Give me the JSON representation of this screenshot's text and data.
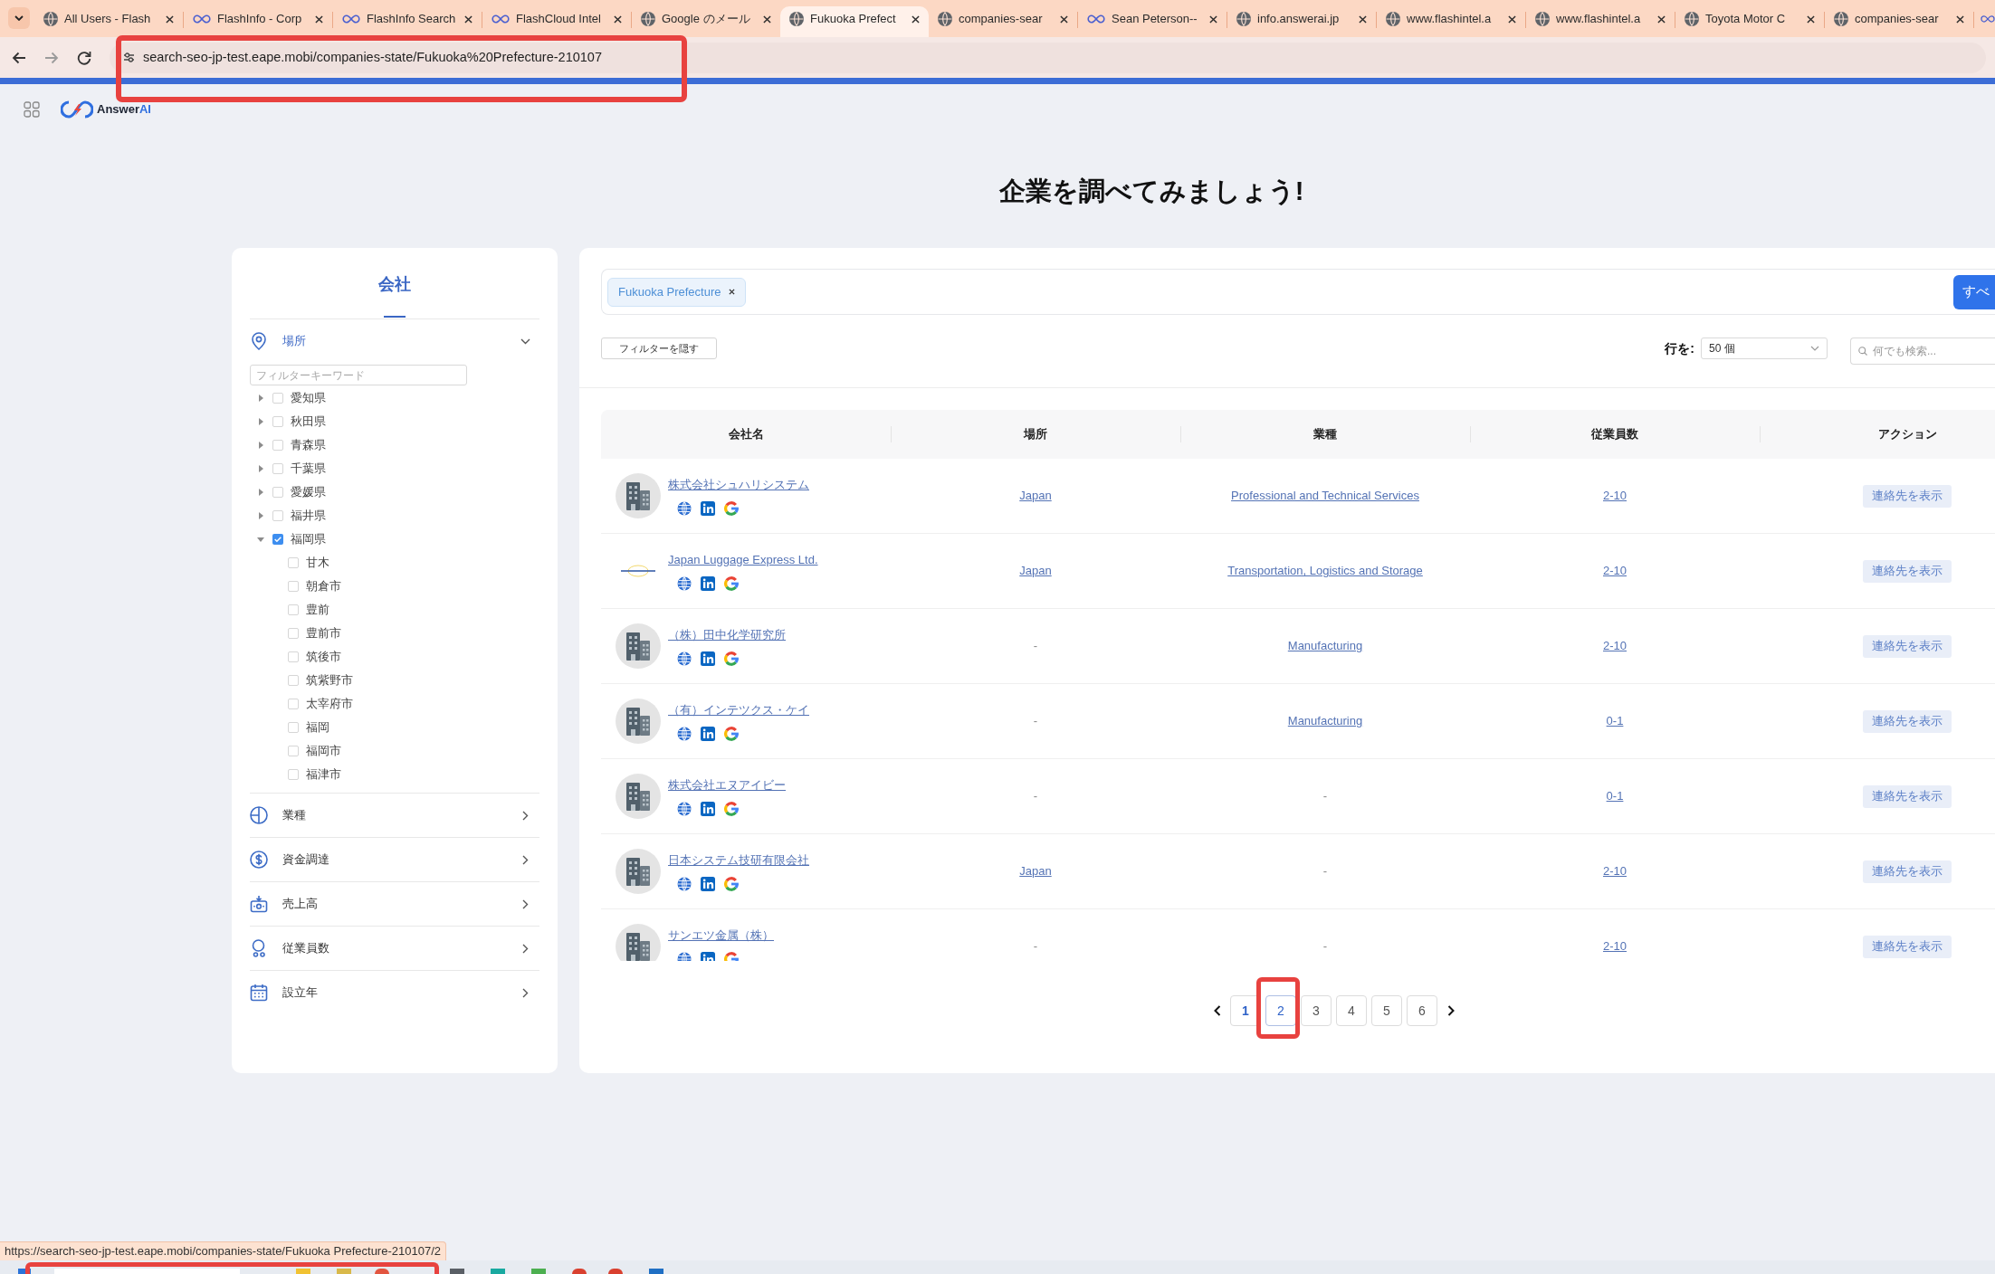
{
  "browser": {
    "tabs": [
      {
        "title": "All Users - Flash",
        "kind": "globe",
        "selected": false
      },
      {
        "title": "FlashInfo - Corp",
        "kind": "link",
        "selected": false
      },
      {
        "title": "FlashInfo Search",
        "kind": "link",
        "selected": false
      },
      {
        "title": "FlashCloud Intel",
        "kind": "link",
        "selected": false
      },
      {
        "title": "Google のメール",
        "kind": "globe",
        "selected": false
      },
      {
        "title": "Fukuoka Prefect",
        "kind": "globe",
        "selected": true
      },
      {
        "title": "companies-sear",
        "kind": "globe",
        "selected": false
      },
      {
        "title": "Sean Peterson--",
        "kind": "link",
        "selected": false
      },
      {
        "title": "info.answerai.jp",
        "kind": "globe",
        "selected": false
      },
      {
        "title": "www.flashintel.a",
        "kind": "globe",
        "selected": false
      },
      {
        "title": "www.flashintel.a",
        "kind": "globe",
        "selected": false
      },
      {
        "title": "Toyota Motor C",
        "kind": "globe",
        "selected": false
      },
      {
        "title": "companies-sear",
        "kind": "globe",
        "selected": false
      },
      {
        "kind": "link",
        "selected": false
      }
    ],
    "address": {
      "url": "search-seo-jp-test.eape.mobi/companies-state/Fukuoka%20Prefecture-210107",
      "highlighted": true
    }
  },
  "app_header": {
    "logo": {
      "text": "Answer",
      "accent": "AI"
    }
  },
  "page_title": "企業を調べてみましょう!",
  "sidebar": {
    "tab": {
      "label": "会社",
      "selected": true
    },
    "sections": [
      {
        "label": "場所",
        "kind": "pin",
        "expanded": true,
        "filter_placeholder": "フィルターキーワード",
        "tree": [
          {
            "label": "愛知県",
            "checked": false,
            "expanded": false
          },
          {
            "label": "秋田県",
            "checked": false,
            "expanded": false
          },
          {
            "label": "青森県",
            "checked": false,
            "expanded": false
          },
          {
            "label": "千葉県",
            "checked": false,
            "expanded": false
          },
          {
            "label": "愛媛県",
            "checked": false,
            "expanded": false
          },
          {
            "label": "福井県",
            "checked": false,
            "expanded": false
          },
          {
            "label": "福岡県",
            "checked": true,
            "expanded": true,
            "children": [
              {
                "label": "甘木",
                "checked": false
              },
              {
                "label": "朝倉市",
                "checked": false
              },
              {
                "label": "豊前",
                "checked": false
              },
              {
                "label": "豊前市",
                "checked": false
              },
              {
                "label": "筑後市",
                "checked": false
              },
              {
                "label": "筑紫野市",
                "checked": false
              },
              {
                "label": "太宰府市",
                "checked": false
              },
              {
                "label": "福岡",
                "checked": false
              },
              {
                "label": "福岡市",
                "checked": false
              },
              {
                "label": "福津市",
                "checked": false
              }
            ]
          }
        ]
      },
      {
        "label": "業種",
        "kind": "pie",
        "expanded": false
      },
      {
        "label": "資金調達",
        "kind": "dollar",
        "expanded": false
      },
      {
        "label": "売上高",
        "kind": "register",
        "expanded": false
      },
      {
        "label": "従業員数",
        "kind": "people",
        "expanded": false
      },
      {
        "label": "設立年",
        "kind": "calendar",
        "expanded": false
      }
    ]
  },
  "results": {
    "tags": [
      {
        "label": "Fukuoka Prefecture"
      }
    ],
    "apply_button": "すべ",
    "hide_filters_button": "フィルターを隠す",
    "rows_label": "行を:",
    "rows_select": "50 個",
    "search_placeholder": "何でも検索...",
    "table": {
      "columns": [
        "会社名",
        "場所",
        "業種",
        "従業員数",
        "アクション"
      ],
      "rows": [
        {
          "company": "株式会社シュハリシステム",
          "logo": {
            "kind": "building"
          },
          "location": {
            "text": "Japan",
            "link": true
          },
          "industry": {
            "text": "Professional and Technical Services",
            "link": true
          },
          "employees": {
            "text": "2-10",
            "link": true
          },
          "action": "連絡先を表示"
        },
        {
          "company": "Japan Luggage Express Ltd.",
          "logo": {
            "kind": "image"
          },
          "location": {
            "text": "Japan",
            "link": true
          },
          "industry": {
            "text": "Transportation, Logistics and Storage",
            "link": true
          },
          "employees": {
            "text": "2-10",
            "link": true
          },
          "action": "連絡先を表示"
        },
        {
          "company": "（株）田中化学研究所",
          "logo": {
            "kind": "building"
          },
          "location": {
            "text": "-",
            "link": false
          },
          "industry": {
            "text": "Manufacturing",
            "link": true
          },
          "employees": {
            "text": "2-10",
            "link": true
          },
          "action": "連絡先を表示"
        },
        {
          "company": "（有）インテツクス・ケイ",
          "logo": {
            "kind": "building"
          },
          "location": {
            "text": "-",
            "link": false
          },
          "industry": {
            "text": "Manufacturing",
            "link": true
          },
          "employees": {
            "text": "0-1",
            "link": true
          },
          "action": "連絡先を表示"
        },
        {
          "company": "株式会社エヌアイビー",
          "logo": {
            "kind": "building"
          },
          "location": {
            "text": "-",
            "link": false
          },
          "industry": {
            "text": "-",
            "link": false
          },
          "employees": {
            "text": "0-1",
            "link": true
          },
          "action": "連絡先を表示"
        },
        {
          "company": "日本システム技研有限会社",
          "logo": {
            "kind": "building"
          },
          "location": {
            "text": "Japan",
            "link": true
          },
          "industry": {
            "text": "-",
            "link": false
          },
          "employees": {
            "text": "2-10",
            "link": true
          },
          "action": "連絡先を表示"
        },
        {
          "company": "サンエツ金属（株）",
          "logo": {
            "kind": "building"
          },
          "location": {
            "text": "-",
            "link": false
          },
          "industry": {
            "text": "-",
            "link": false
          },
          "employees": {
            "text": "2-10",
            "link": true
          },
          "action": "連絡先を表示"
        }
      ]
    },
    "pagination": {
      "pages": [
        {
          "label": "1",
          "selected": true,
          "hovered": false,
          "highlighted": false
        },
        {
          "label": "2",
          "selected": false,
          "hovered": true,
          "highlighted": true
        },
        {
          "label": "3",
          "selected": false,
          "hovered": false,
          "highlighted": false
        },
        {
          "label": "4",
          "selected": false,
          "hovered": false,
          "highlighted": false
        },
        {
          "label": "5",
          "selected": false,
          "hovered": false,
          "highlighted": false
        },
        {
          "label": "6",
          "selected": false,
          "hovered": false,
          "highlighted": false
        }
      ]
    }
  },
  "status_bubble": {
    "url": "https://search-seo-jp-test.eape.mobi/companies-state/Fukuoka Prefecture-210107/2"
  },
  "taskbar": {
    "highlighted": true
  }
}
